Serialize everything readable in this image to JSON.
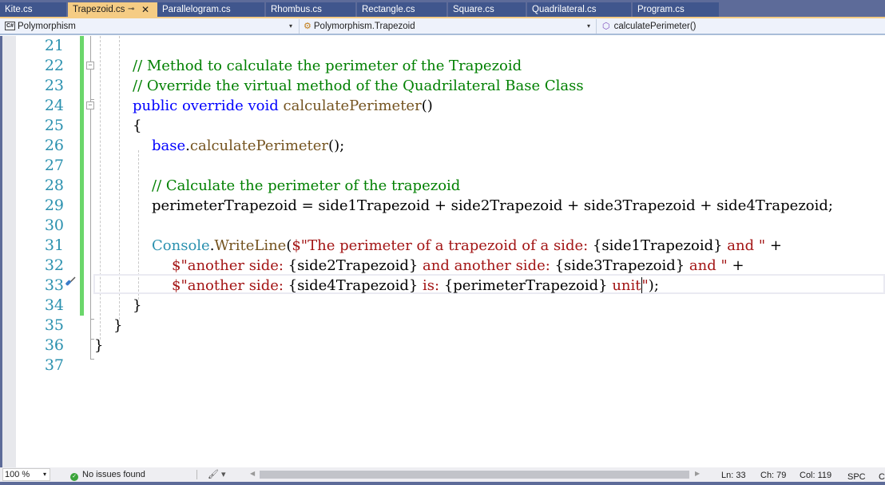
{
  "tabs": [
    {
      "label": "Kite.cs",
      "active": false
    },
    {
      "label": "Trapezoid.cs",
      "active": true,
      "pin_icon": "⊸",
      "close_icon": "✕"
    },
    {
      "label": "Parallelogram.cs",
      "active": false
    },
    {
      "label": "Rhombus.cs",
      "active": false
    },
    {
      "label": "Rectangle.cs",
      "active": false
    },
    {
      "label": "Square.cs",
      "active": false
    },
    {
      "label": "Quadrilateral.cs",
      "active": false
    },
    {
      "label": "Program.cs",
      "active": false
    }
  ],
  "navbar": {
    "project": {
      "icon": "C#",
      "label": "Polymorphism"
    },
    "type": {
      "icon": "class-icon",
      "label": "Polymorphism.Trapezoid"
    },
    "member": {
      "icon": "method-icon",
      "label": "calculatePerimeter()"
    },
    "caret": "▾"
  },
  "editor": {
    "line_numbers": [
      "21",
      "22",
      "23",
      "24",
      "25",
      "26",
      "27",
      "28",
      "29",
      "30",
      "31",
      "32",
      "33",
      "34",
      "35",
      "36",
      "37"
    ],
    "current_line": 33,
    "lines": [
      {
        "n": 21,
        "tokens": []
      },
      {
        "n": 22,
        "tokens": [
          {
            "t": "// Method to calculate the perimeter of the Trapezoid",
            "c": "cm"
          }
        ]
      },
      {
        "n": 23,
        "tokens": [
          {
            "t": "// Override the virtual method of the Quadrilateral Base Class",
            "c": "cm"
          }
        ]
      },
      {
        "n": 24,
        "tokens": [
          {
            "t": "public",
            "c": "kw"
          },
          {
            "t": " "
          },
          {
            "t": "override",
            "c": "kw"
          },
          {
            "t": " "
          },
          {
            "t": "void",
            "c": "kw"
          },
          {
            "t": " "
          },
          {
            "t": "calculatePerimeter",
            "c": "fn"
          },
          {
            "t": "()"
          }
        ]
      },
      {
        "n": 25,
        "tokens": [
          {
            "t": "{"
          }
        ]
      },
      {
        "n": 26,
        "tokens": [
          {
            "t": "base",
            "c": "kw"
          },
          {
            "t": "."
          },
          {
            "t": "calculatePerimeter",
            "c": "fn"
          },
          {
            "t": "();"
          }
        ]
      },
      {
        "n": 27,
        "tokens": []
      },
      {
        "n": 28,
        "tokens": [
          {
            "t": "// Calculate the perimeter of the trapezoid",
            "c": "cm"
          }
        ]
      },
      {
        "n": 29,
        "tokens": [
          {
            "t": "perimeterTrapezoid = side1Trapezoid + side2Trapezoid + side3Trapezoid + side4Trapezoid;"
          }
        ]
      },
      {
        "n": 30,
        "tokens": []
      },
      {
        "n": 31,
        "tokens": [
          {
            "t": "Console",
            "c": "ty"
          },
          {
            "t": "."
          },
          {
            "t": "WriteLine",
            "c": "fn"
          },
          {
            "t": "("
          },
          {
            "t": "$\"The perimeter of a trapezoid of a side: ",
            "c": "st"
          },
          {
            "t": "{side1Trapezoid}"
          },
          {
            "t": " and \"",
            "c": "st"
          },
          {
            "t": " +"
          }
        ]
      },
      {
        "n": 32,
        "tokens": [
          {
            "t": "$\"another side: ",
            "c": "st"
          },
          {
            "t": "{side2Trapezoid}"
          },
          {
            "t": " and another side: ",
            "c": "st"
          },
          {
            "t": "{side3Trapezoid}"
          },
          {
            "t": " and \"",
            "c": "st"
          },
          {
            "t": " +"
          }
        ]
      },
      {
        "n": 33,
        "tokens": [
          {
            "t": "$\"another side: ",
            "c": "st"
          },
          {
            "t": "{side4Trapezoid}"
          },
          {
            "t": " is: ",
            "c": "st"
          },
          {
            "t": "{perimeterTrapezoid}"
          },
          {
            "t": " unit",
            "c": "st"
          },
          {
            "t": "|caret|"
          },
          {
            "t": "\"",
            "c": "st"
          },
          {
            "t": ");"
          }
        ]
      },
      {
        "n": 34,
        "tokens": [
          {
            "t": "}"
          }
        ]
      },
      {
        "n": 35,
        "tokens": [
          {
            "t": "}"
          }
        ]
      },
      {
        "n": 36,
        "tokens": [
          {
            "t": "}"
          }
        ]
      },
      {
        "n": 37,
        "tokens": []
      }
    ]
  },
  "statusbar": {
    "zoom": "100 %",
    "issues": "No issues found",
    "ln": "Ln: 33",
    "ch": "Ch: 79",
    "col": "Col: 119",
    "spc": "SPC",
    "crlf": "C"
  },
  "colors": {
    "keyword": "#0000ff",
    "comment": "#008000",
    "method": "#74531f",
    "type": "#2b91af",
    "string": "#a31515",
    "active_tab": "#f5cc84",
    "tab_strip": "#5d6b99",
    "change_bar": "#6bd76b"
  }
}
